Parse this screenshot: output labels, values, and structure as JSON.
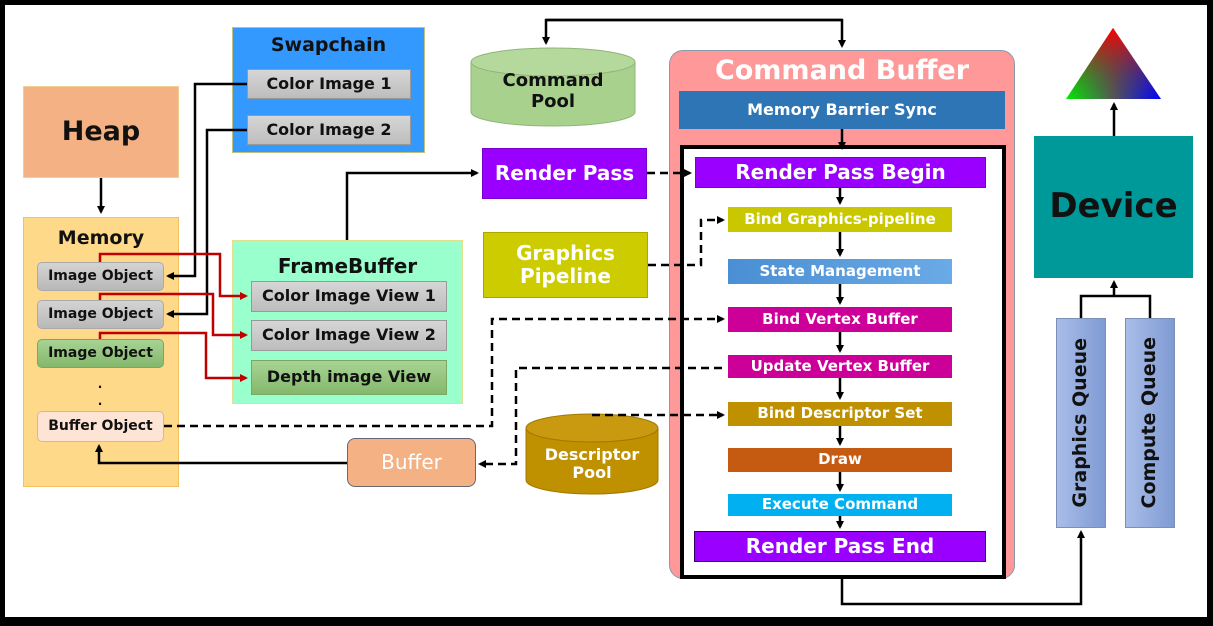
{
  "diagram": {
    "heap": {
      "label": "Heap"
    },
    "memory": {
      "title": "Memory",
      "objects": [
        "Image Object",
        "Image Object",
        "Image Object"
      ],
      "ellipsis": ".",
      "buffer_object": "Buffer Object"
    },
    "swapchain": {
      "title": "Swapchain",
      "images": [
        "Color Image 1",
        "Color Image 2"
      ]
    },
    "framebuffer": {
      "title": "FrameBuffer",
      "views": [
        "Color Image View 1",
        "Color Image View 2",
        "Depth image View"
      ]
    },
    "command_pool": {
      "label_line1": "Command",
      "label_line2": "Pool"
    },
    "render_pass": {
      "label": "Render Pass"
    },
    "graphics_pipeline": {
      "label_line1": "Graphics",
      "label_line2": "Pipeline"
    },
    "buffer": {
      "label": "Buffer"
    },
    "descriptor_pool": {
      "label_line1": "Descriptor",
      "label_line2": "Pool"
    },
    "command_buffer": {
      "title": "Command Buffer",
      "memory_barrier": "Memory Barrier Sync",
      "steps": [
        "Render Pass Begin",
        "Bind Graphics-pipeline",
        "State Management",
        "Bind Vertex Buffer",
        "Update Vertex Buffer",
        "Bind Descriptor Set",
        "Draw",
        "Execute Command",
        "Render Pass End"
      ]
    },
    "device": {
      "label": "Device"
    },
    "queues": [
      "Graphics Queue",
      "Compute Queue"
    ],
    "output_icon": "rgb-triangle-icon"
  },
  "colors": {
    "heap": "#f4b183",
    "memory": "#ffd98a",
    "swapchain": "#3399ff",
    "framebuffer": "#99ffcc",
    "gray_item": "#c8c8c8",
    "green_item": "#93c47d",
    "command_pool": "#a9d18e",
    "render_pass": "#9900ff",
    "graphics_pipeline": "#cccc00",
    "buffer": "#f4b183",
    "descriptor_pool": "#bf9000",
    "command_buffer": "#ff9999",
    "memory_barrier": "#2e75b6",
    "bind_graphics": "#c9c800",
    "state_mgmt": "#5b9bd5",
    "vertex": "#cc0099",
    "descriptor_set": "#bf9000",
    "draw": "#c55a11",
    "execute": "#00b0f0",
    "device": "#009999",
    "queue": "#8faadc",
    "red_arrow": "#c00000"
  }
}
